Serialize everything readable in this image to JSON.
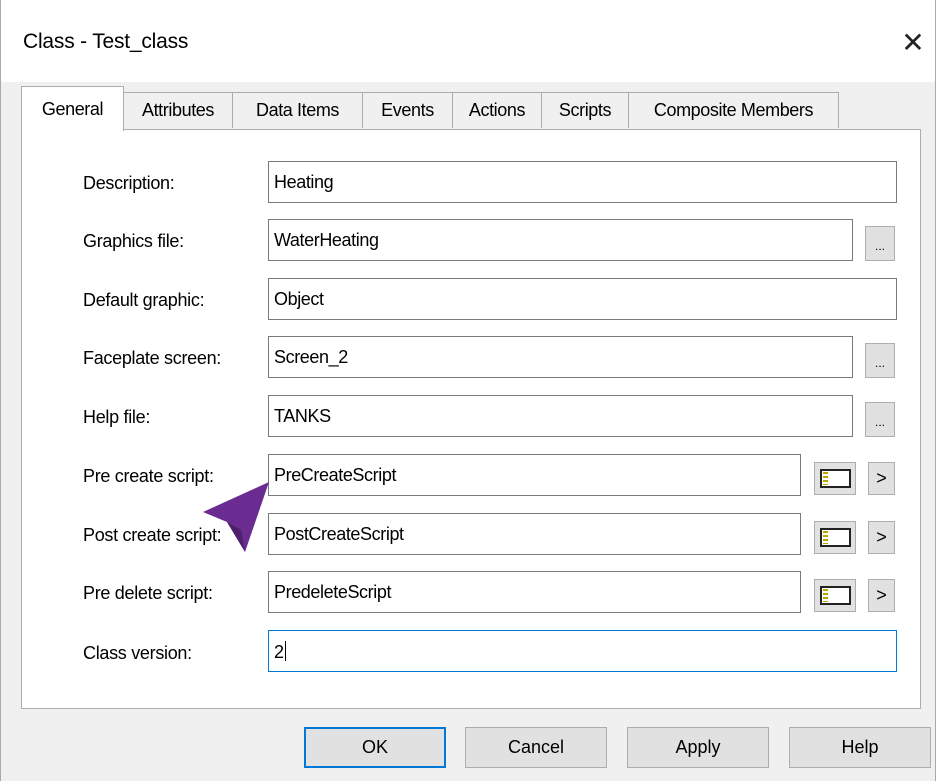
{
  "window": {
    "title": "Class - Test_class",
    "close_glyph": "✕"
  },
  "tabs": [
    {
      "label": "General",
      "active": true
    },
    {
      "label": "Attributes"
    },
    {
      "label": "Data Items"
    },
    {
      "label": "Events"
    },
    {
      "label": "Actions"
    },
    {
      "label": "Scripts"
    },
    {
      "label": "Composite Members"
    }
  ],
  "fields": {
    "description": {
      "label": "Description:",
      "value": "Heating"
    },
    "graphics_file": {
      "label": "Graphics file:",
      "value": "WaterHeating"
    },
    "default_graphic": {
      "label": "Default graphic:",
      "value": "Object"
    },
    "faceplate_screen": {
      "label": "Faceplate screen:",
      "value": "Screen_2"
    },
    "help_file": {
      "label": "Help file:",
      "value": "TANKS"
    },
    "pre_create_script": {
      "label": "Pre create script:",
      "value": "PreCreateScript"
    },
    "post_create_script": {
      "label": "Post create script:",
      "value": "PostCreateScript"
    },
    "pre_delete_script": {
      "label": "Pre delete script:",
      "value": "PredeleteScript"
    },
    "class_version": {
      "label": "Class version:",
      "value": "2"
    }
  },
  "browse_label": "...",
  "arrow_label": ">",
  "buttons": {
    "ok": "OK",
    "cancel": "Cancel",
    "apply": "Apply",
    "help": "Help"
  },
  "colors": {
    "focus": "#0078d7",
    "annotation_arrow": "#6b2c91"
  },
  "icons": {
    "close": "close-icon",
    "script_editor": "script-editor-icon",
    "pointer": "annotation-arrow-icon"
  }
}
